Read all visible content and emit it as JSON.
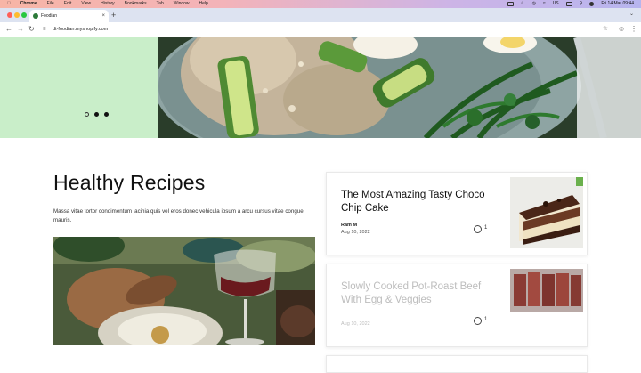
{
  "menubar": {
    "app": "Chrome",
    "items": [
      "File",
      "Edit",
      "View",
      "History",
      "Bookmarks",
      "Tab",
      "Window",
      "Help"
    ],
    "clock": "Fri 14 Mar 09:44",
    "input_source": "US"
  },
  "browser": {
    "tab_title": "Foodian",
    "url": "dt-foodian.myshopify.com"
  },
  "colors": {
    "hero_bg": "#c9eec9",
    "accent": "#111111"
  },
  "hero": {
    "slider_count": 3,
    "active_index": 1
  },
  "section": {
    "title": "Healthy Recipes",
    "description": "Massa vitae tortor condimentum lacinia quis vel eros donec vehicula ipsum a arcu cursus vitae congue mauris."
  },
  "cards": [
    {
      "title": "The Most Amazing Tasty Choco Chip Cake",
      "author": "Ram M",
      "date": "Aug 10, 2022",
      "comments": "1",
      "icon": "comment-icon"
    },
    {
      "title": "Slowly Cooked Pot-Roast Beef With Egg & Veggies",
      "author": "",
      "date": "Aug 10, 2022",
      "comments": "1",
      "icon": "comment-icon"
    }
  ]
}
